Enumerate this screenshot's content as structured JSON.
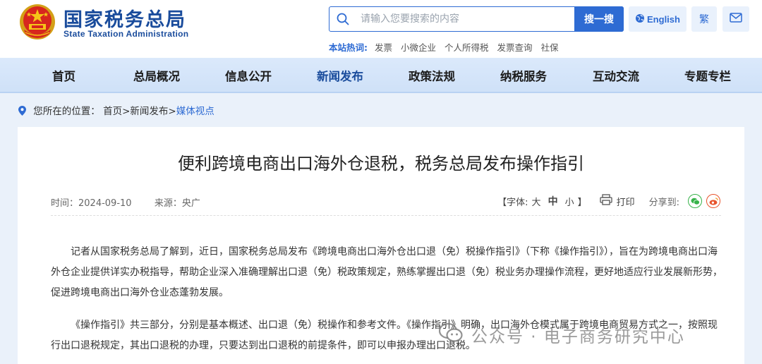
{
  "header": {
    "logo_cn": "国家税务总局",
    "logo_en": "State Taxation Administration",
    "search_placeholder": "请输入您要搜索的内容",
    "search_button": "搜一搜",
    "hot_label": "本站热词:",
    "hot_words": [
      "发票",
      "小微企业",
      "个人所得税",
      "发票查询",
      "社保"
    ],
    "english_label": "English",
    "traditional_label": "繁"
  },
  "nav": {
    "items": [
      "首页",
      "总局概况",
      "信息公开",
      "新闻发布",
      "政策法规",
      "纳税服务",
      "互动交流",
      "专题专栏"
    ],
    "active_index": 3
  },
  "breadcrumb": {
    "prefix": "您所在的位置：",
    "home": "首页",
    "sep1": ">",
    "level1": "新闻发布",
    "sep2": ">",
    "current": "媒体视点"
  },
  "article": {
    "title": "便利跨境电商出口海外仓退税，税务总局发布操作指引",
    "time_label": "时间：",
    "time_value": "2024-09-10",
    "source_label": "来源：",
    "source_value": "央广",
    "font_label_open": "【字体:",
    "font_large": "大",
    "font_medium": "中",
    "font_small": "小",
    "font_label_close": "】",
    "print_label": "打印",
    "share_label": "分享到:",
    "paragraphs": [
      "记者从国家税务总局了解到，近日，国家税务总局发布《跨境电商出口海外仓出口退（免）税操作指引》（下称《操作指引》），旨在为跨境电商出口海外仓企业提供详实办税指导，帮助企业深入准确理解出口退（免）税政策规定，熟练掌握出口退（免）税业务办理操作流程，更好地适应行业发展新形势，促进跨境电商出口海外仓业态蓬勃发展。",
      "《操作指引》共三部分，分别是基本概述、出口退（免）税操作和参考文件。《操作指引》明确，出口海外仓模式属于跨境电商贸易方式之一，按照现行出口退税规定，其出口退税的办理，只要达到出口退税的前提条件，即可以申报办理出口退税。"
    ]
  },
  "watermark": {
    "text": "公众号 · 电子商务研究中心"
  },
  "colors": {
    "brand_blue": "#1a4c9c",
    "accent_blue": "#2e6bd3",
    "nav_bg": "#d5e5f9",
    "page_bg": "#eaf1fa"
  }
}
